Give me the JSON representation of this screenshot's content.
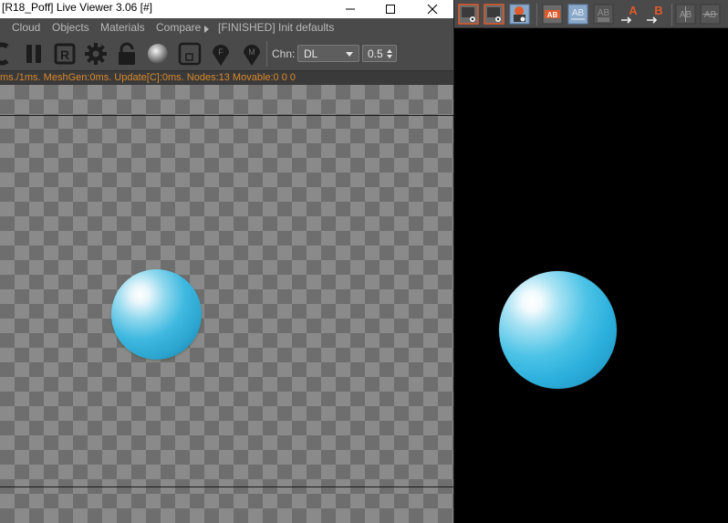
{
  "window": {
    "title": "[R18_Poff] Live Viewer 3.06 [#]"
  },
  "menu": {
    "items": [
      "Cloud",
      "Objects",
      "Materials",
      "Compare"
    ],
    "status": "[FINISHED] Init defaults"
  },
  "toolbar": {
    "icons": [
      "restart-icon",
      "pause-icon",
      "region-render-icon",
      "settings-gear-icon",
      "lock-icon",
      "material-ball-icon",
      "frame-icon",
      "focus-pick-icon",
      "material-pick-icon"
    ],
    "channel_label": "Chn:",
    "channel_value": "DL",
    "exposure_value": "0.5"
  },
  "stats": {
    "text": "ms./1ms. MeshGen:0ms. Update[C]:0ms. Nodes:13 Movable:0  0 0"
  },
  "right_toolbar": {
    "icons": [
      "snapshot-a-icon",
      "snapshot-b-icon",
      "snapshot-compare-icon",
      "ab-red-icon",
      "ab-blue-icon",
      "ab-gray-icon",
      "send-to-a-icon",
      "send-to-b-icon",
      "ab-split-vertical-icon",
      "ab-split-horizontal-icon"
    ],
    "send_a_label": "A",
    "send_b_label": "B",
    "ab_label": "AB"
  },
  "colors": {
    "stats_text": "#d9882c",
    "accent_orange": "#e05a2a",
    "sphere": "#3fb9e0"
  }
}
